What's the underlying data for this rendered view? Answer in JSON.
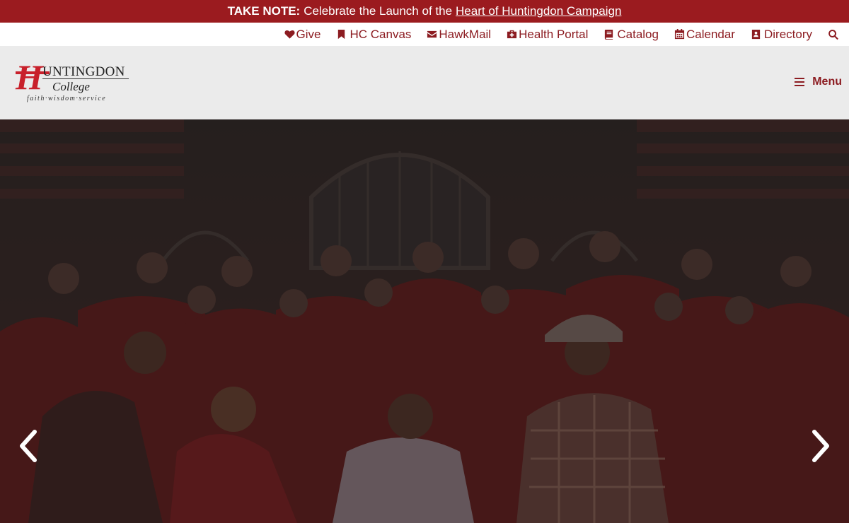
{
  "announcement": {
    "label": "TAKE NOTE:",
    "text": "Celebrate the Launch of the",
    "link": "Heart of Huntingdon Campaign"
  },
  "utility_nav": [
    {
      "label": "Give",
      "icon": "heart-icon"
    },
    {
      "label": "HC Canvas",
      "icon": "bookmark-icon"
    },
    {
      "label": "HawkMail",
      "icon": "envelope-icon"
    },
    {
      "label": "Health Portal",
      "icon": "medkit-icon"
    },
    {
      "label": "Catalog",
      "icon": "book-icon"
    },
    {
      "label": "Calendar",
      "icon": "calendar-icon"
    },
    {
      "label": "Directory",
      "icon": "address-book-icon"
    }
  ],
  "logo": {
    "initial": "H",
    "name": "UNTINGDON",
    "college": "College",
    "tagline": "faith·wisdom·service"
  },
  "header": {
    "menu_label": "Menu"
  },
  "colors": {
    "brand": "#9b1b1f",
    "accent": "#8c1c21",
    "header_bg": "#ebebeb"
  },
  "hero": {
    "slides_nav": [
      "previous-slide",
      "next-slide"
    ]
  }
}
